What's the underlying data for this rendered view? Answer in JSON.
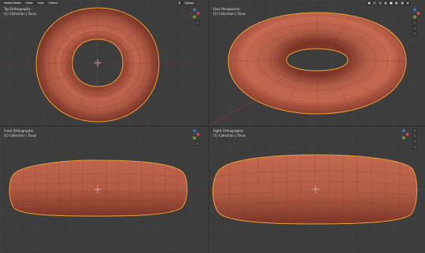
{
  "header": {
    "mode": "Object Mode",
    "menus": [
      "View",
      "Add",
      "Object"
    ],
    "orientation": "Global"
  },
  "viewports": [
    {
      "view": "Top Orthographic",
      "collection": "(1) Collection | Torus"
    },
    {
      "view": "User Perspective",
      "collection": "(1) Collection | Torus"
    },
    {
      "view": "Front Orthographic",
      "collection": "(1) Collection | Torus"
    },
    {
      "view": "Right Orthographic",
      "collection": "(1) Collection | Torus"
    }
  ],
  "colors": {
    "viewport_bg": "#3d3d3d",
    "grid": "#474747",
    "mesh": "#b55a45",
    "wire": "#7a3727",
    "outline": "#f0a030",
    "axis_x": "#c84a50",
    "axis_y": "#6f9c3a",
    "axis_z": "#3a74c8"
  },
  "icons": [
    "gizmo-icon",
    "zoom-icon",
    "hand-icon",
    "camera-icon",
    "grid-icon"
  ]
}
